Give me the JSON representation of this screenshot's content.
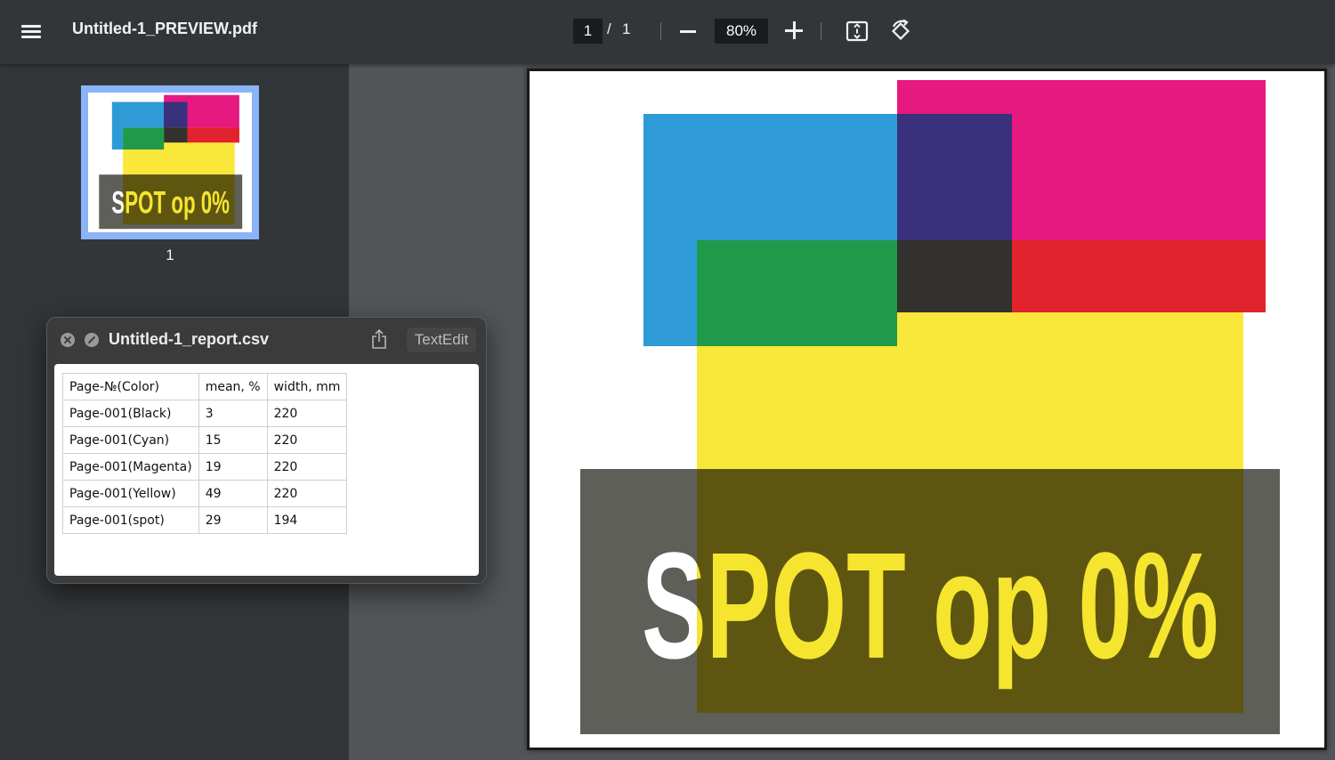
{
  "toolbar": {
    "menu_icon": "hamburger-menu-icon",
    "title": "Untitled-1_PREVIEW.pdf",
    "page_current": "1",
    "page_separator": "/",
    "page_total": "1",
    "zoom_out_icon": "minus-icon",
    "zoom_level": "80%",
    "zoom_in_icon": "plus-icon",
    "fit_icon": "fit-to-page-icon",
    "rotate_icon": "rotate-counterclockwise-icon"
  },
  "sidebar": {
    "thumbnails": [
      {
        "label": "1",
        "text": "SPOT op 0%"
      }
    ]
  },
  "document": {
    "page_text": "SPOT op 0%",
    "colors": {
      "cyan": "#2e9bd6",
      "magenta": "#e5197f",
      "yellow": "#f9e83a",
      "green": "#1f9a4a",
      "red": "#e0232c",
      "navy": "#39317c",
      "dark": "#33312d",
      "spot_gray": "#5e5f59",
      "spot_olive": "#5e5610",
      "spot_text_yellow": "#f5e52f"
    }
  },
  "textedit": {
    "close_icon": "close-icon",
    "disabled_icon": "disabled-minimize-icon",
    "title": "Untitled-1_report.csv",
    "share_icon": "share-icon",
    "open_button": "TextEdit",
    "table": {
      "headers": [
        "Page-№(Color)",
        "mean, %",
        "width, mm"
      ],
      "rows": [
        [
          "Page-001(Black)",
          "3",
          "220"
        ],
        [
          "Page-001(Cyan)",
          "15",
          "220"
        ],
        [
          "Page-001(Magenta)",
          "19",
          "220"
        ],
        [
          "Page-001(Yellow)",
          "49",
          "220"
        ],
        [
          "Page-001(spot)",
          "29",
          "194"
        ]
      ]
    }
  }
}
